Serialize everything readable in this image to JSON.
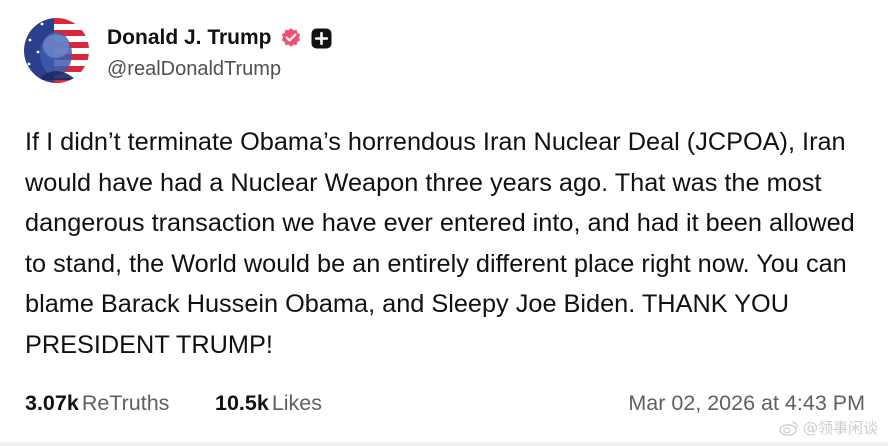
{
  "post": {
    "author": {
      "display_name": "Donald J. Trump",
      "handle": "@realDonaldTrump",
      "avatar_icon": "avatar-portrait-flag",
      "verified_icon": "verified-badge-icon",
      "verified_color": "#f0506e",
      "action_icon": "plus-square-icon"
    },
    "body": "If I didn’t terminate Obama’s horrendous Iran Nuclear Deal (JCPOA), Iran would have had a Nuclear Weapon three years ago. That was the most dangerous transaction we have ever entered into, and had it been allowed to stand, the World would be an entirely different place right now. You can blame Barack Hussein Obama, and Sleepy Joe Biden. THANK YOU PRESIDENT TRUMP!",
    "stats": {
      "retruths_count": "3.07k",
      "retruths_label": "ReTruths",
      "likes_count": "10.5k",
      "likes_label": "Likes"
    },
    "timestamp": "Mar 02, 2026 at 4:43 PM"
  },
  "watermark": {
    "text": "@领事闲谈",
    "icon": "weibo-icon"
  }
}
